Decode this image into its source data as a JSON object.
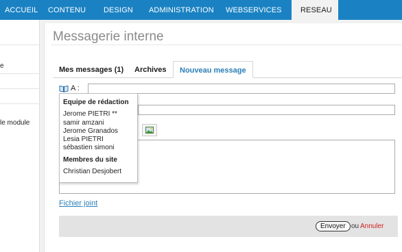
{
  "nav": {
    "tabs": [
      {
        "label": "ACCUEIL"
      },
      {
        "label": "CONTENU"
      },
      {
        "label": "DESIGN"
      },
      {
        "label": "ADMINISTRATION"
      },
      {
        "label": "WEBSERVICES"
      },
      {
        "label": "RESEAU",
        "active": true
      }
    ],
    "accent": "#1a82c3"
  },
  "sidebar": {
    "items": [
      "e",
      "le module"
    ]
  },
  "page": {
    "title": "Messagerie interne"
  },
  "tabs": {
    "my_messages": "Mes messages (1)",
    "archives": "Archives",
    "new_message": "Nouveau message"
  },
  "form": {
    "to_label": "A :",
    "to_value": "",
    "subject_value": "",
    "attach_link": "Fichier joint",
    "send_label": "Envoyer",
    "or_label": "ou",
    "cancel_label": "Annuler"
  },
  "dropdown": {
    "groups": [
      {
        "name": "Equipe de rédaction",
        "members": [
          "Jerome PIETRI **",
          "samir amzani",
          "Jerome Granados",
          "Lesia PIETRI",
          "sébastien simoni"
        ]
      },
      {
        "name": "Membres du site",
        "members": [
          "Christian Desjobert"
        ]
      }
    ]
  },
  "icons": {
    "address_book": "book-icon",
    "insert_image": "image-icon"
  },
  "colors": {
    "link": "#2a7fb8",
    "cancel": "#d21e1e"
  }
}
